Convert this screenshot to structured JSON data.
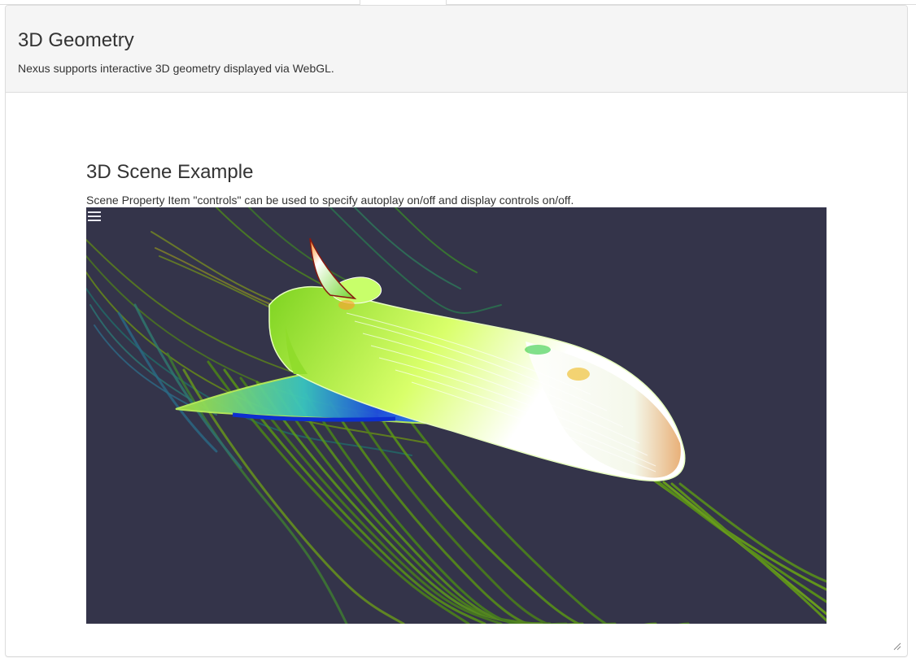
{
  "header": {
    "title": "3D Geometry",
    "description": "Nexus supports interactive 3D geometry displayed via WebGL."
  },
  "scene": {
    "title": "3D Scene Example",
    "description": "Scene Property Item \"controls\" can be used to specify autoplay on/off and display controls on/off.",
    "menu_icon": "hamburger-menu-icon",
    "resize_icon": "resize-grip-icon",
    "background_color": "#34344a"
  },
  "colors": {
    "panel_heading_bg": "#f5f5f5",
    "border": "#dddddd",
    "streamline_green": "#5a9a10",
    "streamline_teal": "#1f7a6a"
  }
}
